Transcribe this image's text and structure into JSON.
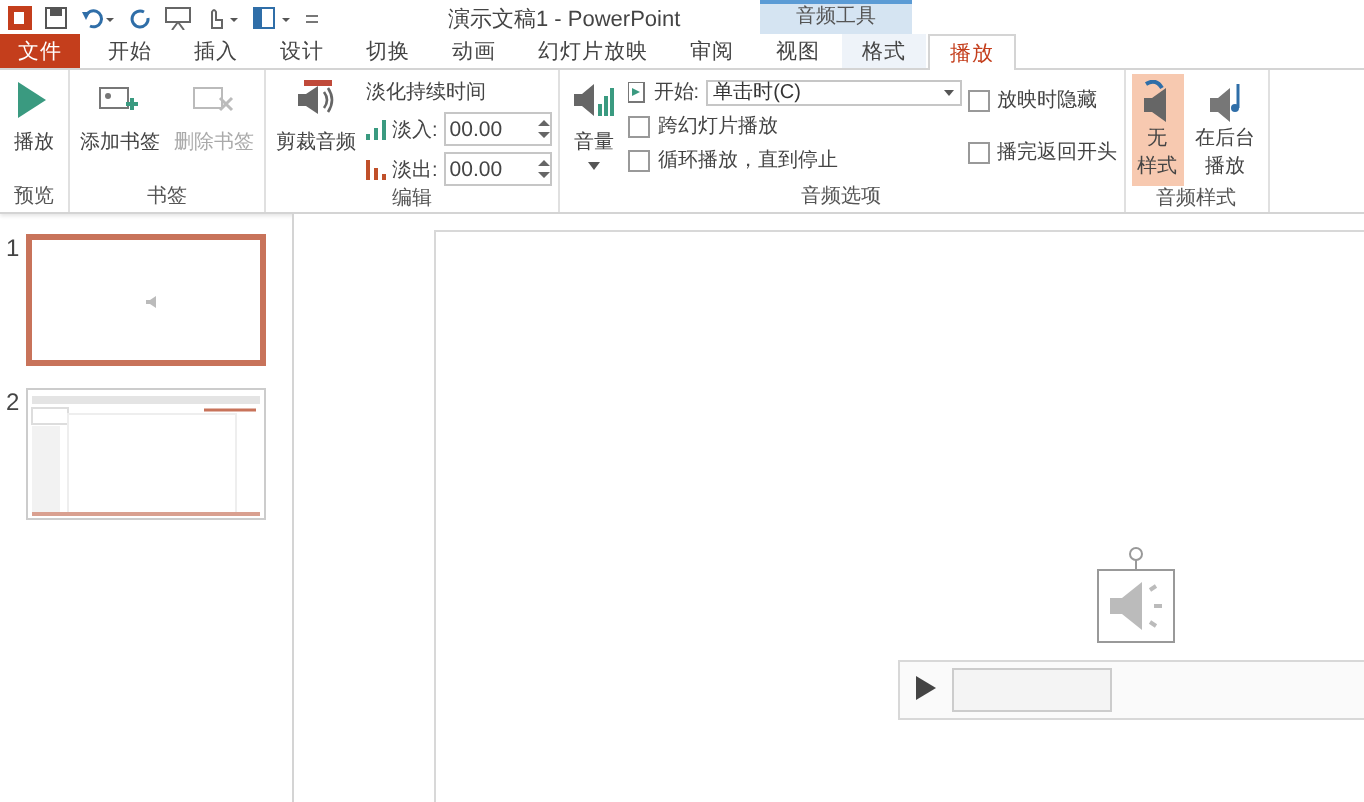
{
  "title_bar": {
    "title": "演示文稿1 - PowerPoint",
    "context_label": "音频工具"
  },
  "tabs": [
    {
      "label": "文件",
      "kind": "file",
      "selected": false
    },
    {
      "label": "开始",
      "kind": "tab",
      "selected": false
    },
    {
      "label": "插入",
      "kind": "tab",
      "selected": false
    },
    {
      "label": "设计",
      "kind": "tab",
      "selected": false
    },
    {
      "label": "切换",
      "kind": "tab",
      "selected": false
    },
    {
      "label": "动画",
      "kind": "tab",
      "selected": false
    },
    {
      "label": "幻灯片放映",
      "kind": "tab",
      "selected": false
    },
    {
      "label": "审阅",
      "kind": "tab",
      "selected": false
    },
    {
      "label": "视图",
      "kind": "tab",
      "selected": false
    },
    {
      "label": "格式",
      "kind": "context",
      "selected": false
    },
    {
      "label": "播放",
      "kind": "context",
      "selected": true
    }
  ],
  "ribbon": {
    "groups": [
      {
        "label": "预览",
        "items": [
          {
            "kind": "large",
            "label": "播放",
            "disabled": false
          }
        ]
      },
      {
        "label": "书签",
        "items": [
          {
            "kind": "large",
            "label": "添加书签",
            "disabled": false
          },
          {
            "kind": "large",
            "label": "删除书签",
            "disabled": true
          }
        ]
      },
      {
        "label": "编辑",
        "items": [
          {
            "kind": "large",
            "label": "剪裁音频",
            "disabled": false
          },
          {
            "kind": "fade",
            "title": "淡化持续时间",
            "fields": [
              {
                "label": "淡入:",
                "value": "00.00"
              },
              {
                "label": "淡出:",
                "value": "00.00"
              }
            ]
          }
        ]
      },
      {
        "label": "音频选项",
        "items": [
          {
            "kind": "large",
            "label": "音量",
            "disabled": false,
            "dropdown": true
          },
          {
            "kind": "options",
            "start": {
              "label": "开始:",
              "value": "单击时(C)"
            },
            "checks": [
              {
                "label": "跨幻灯片播放",
                "checked": false
              },
              {
                "label": "循环播放，直到停止",
                "checked": false
              }
            ]
          },
          {
            "kind": "checks",
            "checks": [
              {
                "label": "放映时隐藏",
                "checked": false
              },
              {
                "label": "播完返回开头",
                "checked": false
              }
            ]
          }
        ]
      },
      {
        "label": "音频样式",
        "items": [
          {
            "kind": "style",
            "lines": [
              "无",
              "样式"
            ],
            "selected": true
          },
          {
            "kind": "style",
            "lines": [
              "在后台",
              "播放"
            ],
            "selected": false
          }
        ]
      }
    ]
  },
  "slides": [
    {
      "number": "1",
      "selected": true
    },
    {
      "number": "2",
      "selected": false
    }
  ]
}
